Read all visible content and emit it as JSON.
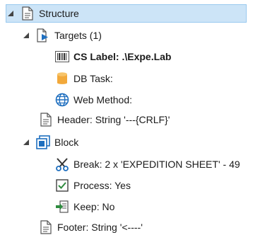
{
  "tree": {
    "root": {
      "label": "Structure",
      "icon": "document-icon",
      "expanded": true,
      "selected": true
    },
    "targets": {
      "label": "Targets (1)",
      "icon": "targets-document-icon",
      "expanded": true
    },
    "cs_label": {
      "label": "CS Label: .\\Expe.Lab",
      "icon": "barcode-icon"
    },
    "db_task": {
      "label": "DB Task:",
      "icon": "database-icon"
    },
    "web_method": {
      "label": "Web Method:",
      "icon": "globe-icon"
    },
    "header": {
      "label": "Header: String '---{CRLF}'",
      "icon": "document-icon"
    },
    "block": {
      "label": "Block",
      "icon": "block-icon",
      "expanded": true
    },
    "break": {
      "label": "Break: 2 x 'EXPEDITION SHEET' - 49",
      "icon": "scissors-icon"
    },
    "process": {
      "label": "Process: Yes",
      "icon": "checkbox-checked-icon"
    },
    "keep": {
      "label": "Keep: No",
      "icon": "keep-icon"
    },
    "footer": {
      "label": "Footer: String '<----'",
      "icon": "document-icon"
    }
  },
  "colors": {
    "selection_bg": "#cce4f7",
    "selection_border": "#99c9ef",
    "blue_icon": "#1f6fbf",
    "database_gold": "#f2a93b"
  }
}
